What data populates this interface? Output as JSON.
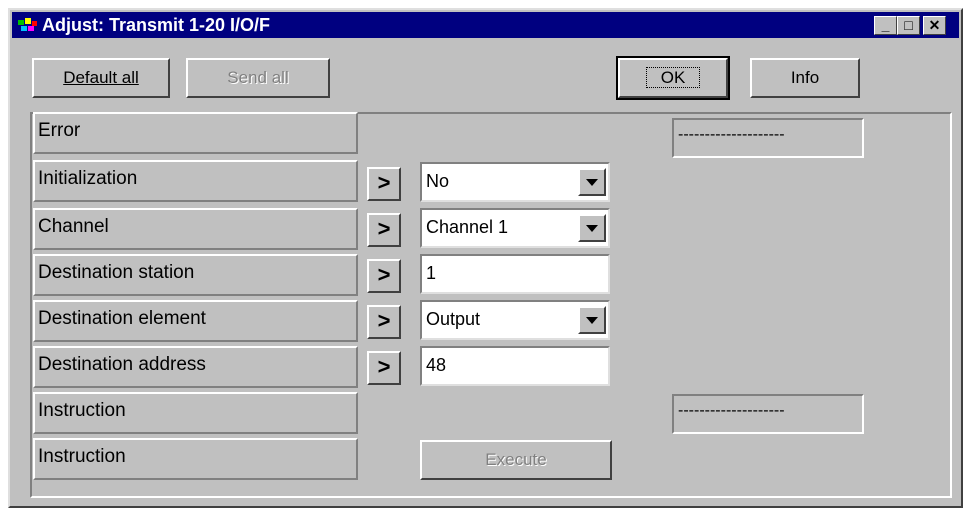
{
  "window": {
    "title": "Adjust: Transmit 1-20 I/O/F",
    "minimize": "_",
    "maximize": "□",
    "close": "✕"
  },
  "toolbar": {
    "default_all": "Default all",
    "send_all": "Send all",
    "ok": "OK",
    "info": "Info"
  },
  "rows": [
    {
      "label": "Error",
      "readout": "--------------------"
    },
    {
      "label": "Initialization",
      "value": "No"
    },
    {
      "label": "Channel",
      "value": "Channel 1"
    },
    {
      "label": "Destination station",
      "value": "1"
    },
    {
      "label": "Destination element",
      "value": "Output"
    },
    {
      "label": "Destination address",
      "value": "48"
    },
    {
      "label": "Instruction",
      "readout": "--------------------"
    },
    {
      "label": "Instruction",
      "button": "Execute"
    }
  ],
  "arrow_label": ">"
}
